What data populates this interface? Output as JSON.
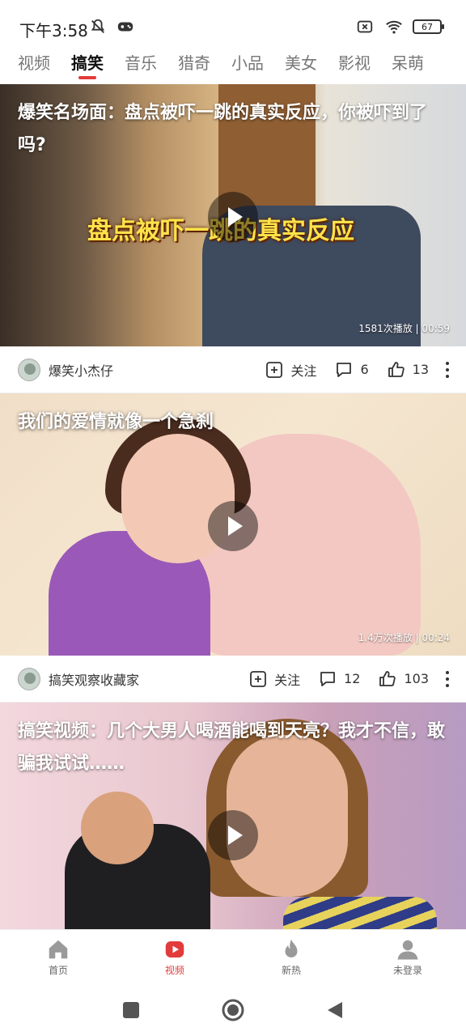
{
  "status_bar": {
    "time": "下午3:58",
    "battery": "67",
    "icons_left": [
      "mute-icon",
      "game-icon"
    ],
    "icons_right": [
      "sim-off-icon",
      "wifi-icon",
      "battery-icon"
    ]
  },
  "tabs": [
    {
      "label": "视频",
      "active": false
    },
    {
      "label": "搞笑",
      "active": true
    },
    {
      "label": "音乐",
      "active": false
    },
    {
      "label": "猎奇",
      "active": false
    },
    {
      "label": "小品",
      "active": false
    },
    {
      "label": "美女",
      "active": false
    },
    {
      "label": "影视",
      "active": false
    },
    {
      "label": "呆萌",
      "active": false
    }
  ],
  "feed": [
    {
      "title": "爆笑名场面：盘点被吓一跳的真实反应，你被吓到了吗?",
      "overlay_text": "盘点被吓一跳的真实反应",
      "meta": "1581次播放 | 00:59",
      "author": "爆笑小杰仔",
      "follow": "关注",
      "comments": "6",
      "likes": "13"
    },
    {
      "title": "我们的爱情就像一个急刹",
      "meta": "1.4万次播放 | 00:24",
      "author": "搞笑观察收藏家",
      "follow": "关注",
      "comments": "12",
      "likes": "103"
    },
    {
      "title": "搞笑视频：几个大男人喝酒能喝到天亮？我才不信，敢骗我试试……",
      "meta": "",
      "author": "",
      "follow": "",
      "comments": "",
      "likes": ""
    }
  ],
  "bottom_nav": [
    {
      "label": "首页",
      "icon": "home-icon",
      "active": false
    },
    {
      "label": "视频",
      "icon": "video-icon",
      "active": true
    },
    {
      "label": "新热",
      "icon": "flame-icon",
      "active": false
    },
    {
      "label": "未登录",
      "icon": "user-icon",
      "active": false
    }
  ],
  "colors": {
    "accent": "#e23b3b",
    "inactive": "#999999"
  }
}
